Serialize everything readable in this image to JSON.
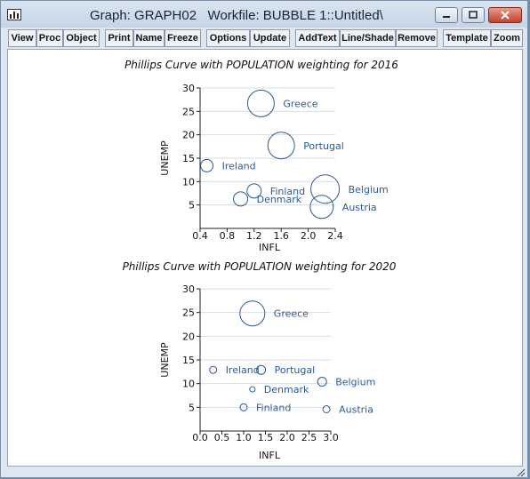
{
  "window": {
    "title": "Graph: GRAPH02   Workfile: BUBBLE 1::Untitled\\"
  },
  "toolbar": {
    "buttons": [
      "View",
      "Proc",
      "Object",
      "Print",
      "Name",
      "Freeze",
      "Options",
      "Update",
      "AddText",
      "Line/Shade",
      "Remove",
      "Template",
      "Zoom"
    ]
  },
  "colors": {
    "series": "#2a5a9a",
    "grid": "#d8dde5"
  },
  "icons": {
    "app": "graph-app-icon",
    "minimize": "minimize-icon",
    "maximize": "maximize-icon",
    "close": "close-icon",
    "resize": "resize-grip-icon"
  },
  "chart_data": [
    {
      "type": "scatter",
      "title": "Phillips Curve with POPULATION weighting for 2016",
      "xlabel": "INFL",
      "ylabel": "UNEMP",
      "xlim": [
        0.4,
        2.4
      ],
      "ylim": [
        0,
        30
      ],
      "xticks": [
        "0.4",
        "0.8",
        "1.2",
        "1.6",
        "2.0",
        "2.4"
      ],
      "yticks": [
        "5",
        "10",
        "15",
        "20",
        "25",
        "30"
      ],
      "grid": true,
      "points": [
        {
          "label": "Greece",
          "x": 1.3,
          "y": 26.7,
          "r": 15
        },
        {
          "label": "Portugal",
          "x": 1.6,
          "y": 17.7,
          "r": 15
        },
        {
          "label": "Ireland",
          "x": 0.5,
          "y": 13.4,
          "r": 7
        },
        {
          "label": "Finland",
          "x": 1.2,
          "y": 8.0,
          "r": 8
        },
        {
          "label": "Denmark",
          "x": 1.0,
          "y": 6.3,
          "r": 8
        },
        {
          "label": "Belgium",
          "x": 2.25,
          "y": 8.4,
          "r": 16
        },
        {
          "label": "Austria",
          "x": 2.2,
          "y": 4.6,
          "r": 13
        }
      ]
    },
    {
      "type": "scatter",
      "title": "Phillips Curve with POPULATION weighting for 2020",
      "xlabel": "INFL",
      "ylabel": "UNEMP",
      "xlim": [
        0.0,
        3.0
      ],
      "ylim": [
        0,
        30
      ],
      "xticks": [
        "0.0",
        "0.5",
        "1.0",
        "1.5",
        "2.0",
        "2.5",
        "3.0"
      ],
      "yticks": [
        "5",
        "10",
        "15",
        "20",
        "25",
        "30"
      ],
      "grid": true,
      "points": [
        {
          "label": "Greece",
          "x": 1.2,
          "y": 24.8,
          "r": 14
        },
        {
          "label": "Ireland",
          "x": 0.3,
          "y": 12.9,
          "r": 4
        },
        {
          "label": "Portugal",
          "x": 1.4,
          "y": 12.9,
          "r": 5
        },
        {
          "label": "Denmark",
          "x": 1.2,
          "y": 8.8,
          "r": 3
        },
        {
          "label": "Belgium",
          "x": 2.8,
          "y": 10.4,
          "r": 5
        },
        {
          "label": "Finland",
          "x": 1.0,
          "y": 5.0,
          "r": 4
        },
        {
          "label": "Austria",
          "x": 2.9,
          "y": 4.6,
          "r": 4
        }
      ]
    }
  ]
}
